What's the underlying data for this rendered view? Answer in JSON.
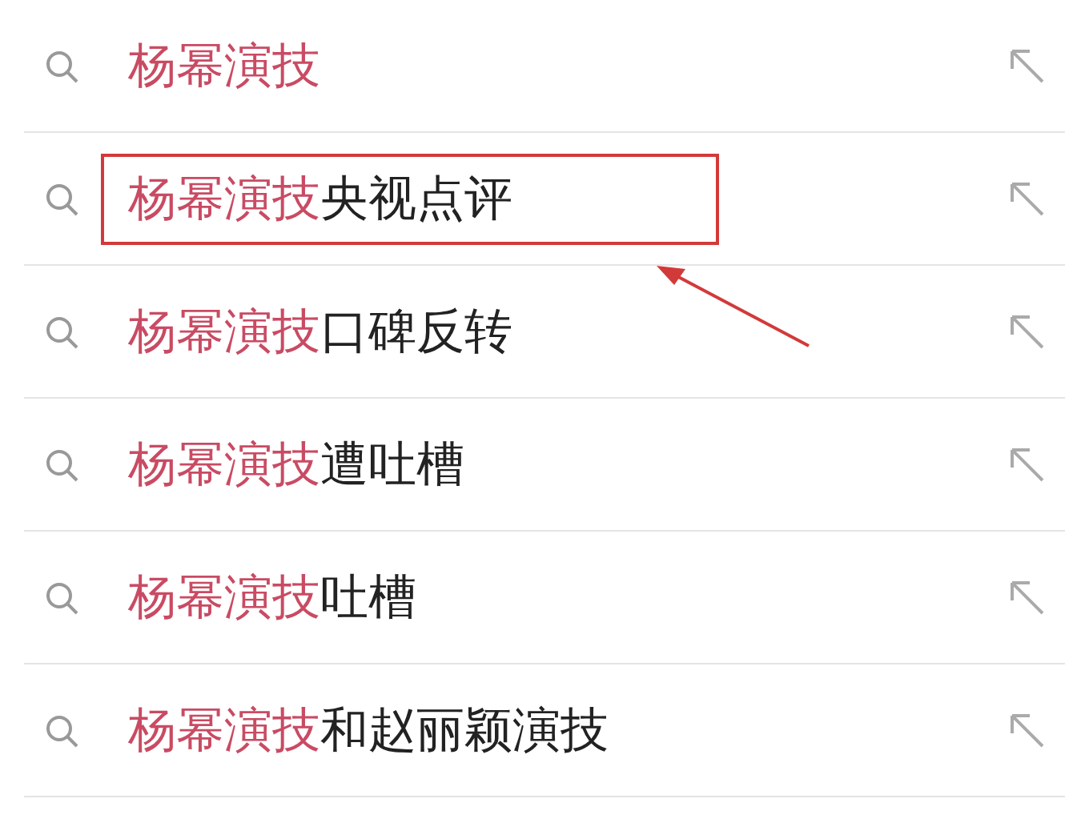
{
  "suggestions": [
    {
      "match": "杨幂演技",
      "highlighted": false
    },
    {
      "match": "杨幂演技",
      "rest": "央视点评",
      "highlighted": true
    },
    {
      "match": "杨幂演技",
      "rest": "口碑反转",
      "highlighted": false
    },
    {
      "match": "杨幂演技",
      "rest": "遭吐槽",
      "highlighted": false
    },
    {
      "match": "杨幂演技",
      "rest": "吐槽",
      "highlighted": false
    },
    {
      "match": "杨幂演技",
      "rest": "和赵丽颖演技",
      "highlighted": false
    }
  ]
}
